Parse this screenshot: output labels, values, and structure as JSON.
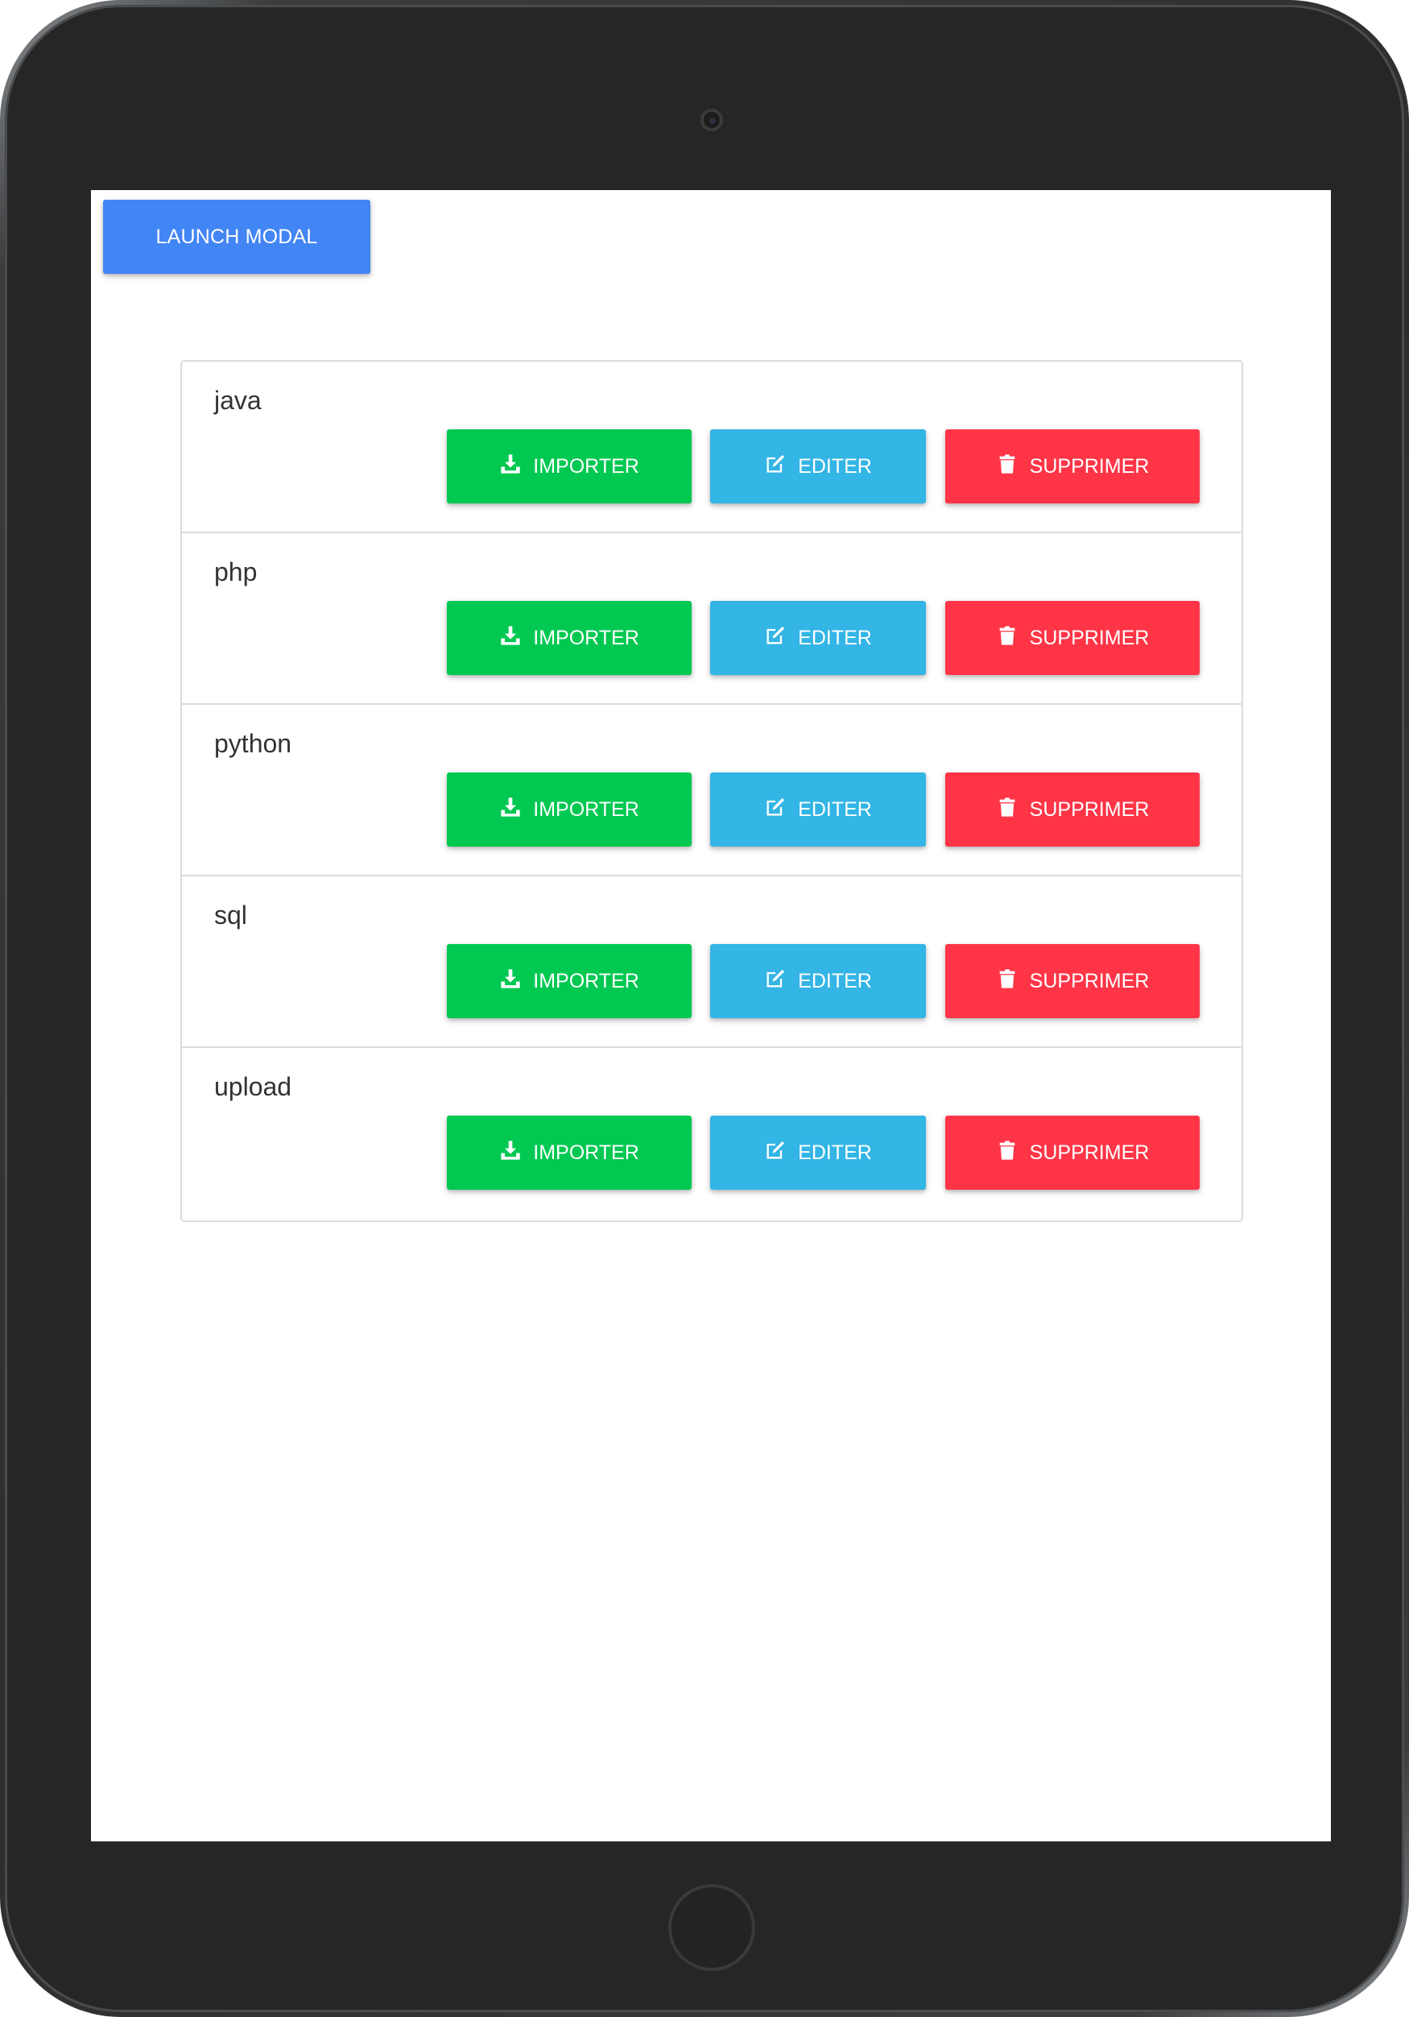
{
  "header": {
    "launch_label": "LAUNCH MODAL"
  },
  "colors": {
    "launch": "#4285f4",
    "import": "#00c851",
    "edit": "#33b5e5",
    "delete": "#ff3547"
  },
  "actions": {
    "import_label": "IMPORTER",
    "edit_label": "EDITER",
    "delete_label": "SUPPRIMER",
    "import_icon": "download-icon",
    "edit_icon": "edit-icon",
    "delete_icon": "trash-icon"
  },
  "items": [
    {
      "name": "java"
    },
    {
      "name": "php"
    },
    {
      "name": "python"
    },
    {
      "name": "sql"
    },
    {
      "name": "upload"
    }
  ]
}
